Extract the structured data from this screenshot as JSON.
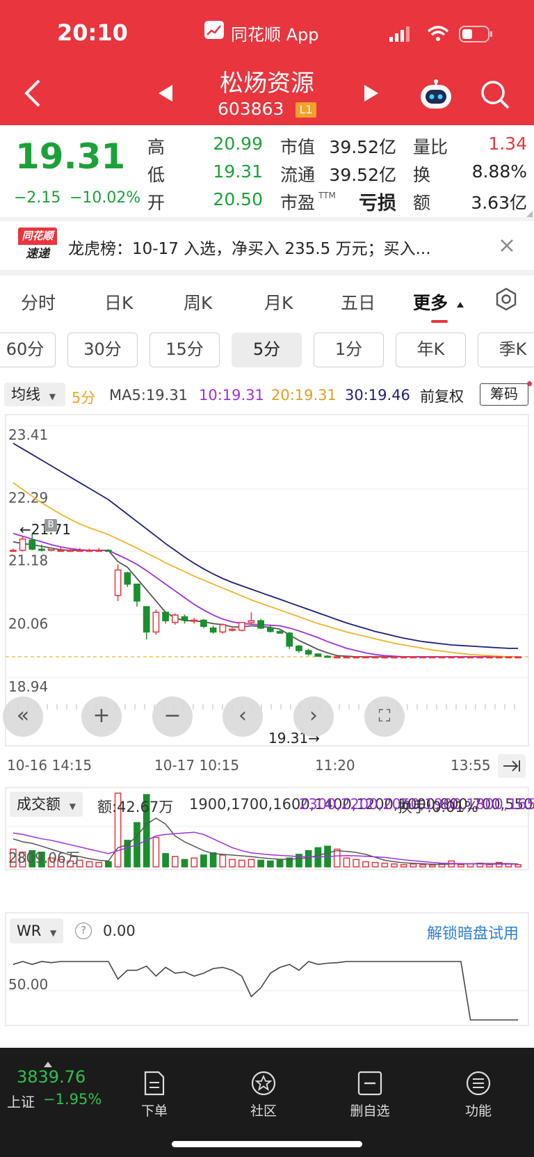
{
  "status": {
    "time": "20:10",
    "app_label": "同花顺 App"
  },
  "header": {
    "stock_name": "松炀资源",
    "stock_code": "603863",
    "level_badge": "L1"
  },
  "quote": {
    "price": "19.31",
    "change": "−2.15",
    "change_pct": "−10.02%",
    "high_label": "高",
    "high": "20.99",
    "low_label": "低",
    "low": "19.31",
    "open_label": "开",
    "open": "20.50",
    "mktcap_label": "市值",
    "mktcap": "39.52亿",
    "float_label": "流通",
    "float": "39.52亿",
    "pe_label": "市盈",
    "pe_sup": "TTM",
    "pe": "亏损",
    "volratio_label": "量比",
    "volratio": "1.34",
    "turnover_label": "换",
    "turnover": "8.88%",
    "amount_label": "额",
    "amount": "3.63亿"
  },
  "news": {
    "logo_top": "同花顺",
    "logo_bottom": "速递",
    "text": "龙虎榜：10-17 入选，净买入 235.5 万元；买入..."
  },
  "tabs": [
    {
      "label": "分时"
    },
    {
      "label": "日K"
    },
    {
      "label": "周K"
    },
    {
      "label": "月K"
    },
    {
      "label": "五日"
    },
    {
      "label": "更多"
    }
  ],
  "periods": [
    {
      "label": "60分"
    },
    {
      "label": "30分"
    },
    {
      "label": "15分"
    },
    {
      "label": "5分"
    },
    {
      "label": "1分"
    },
    {
      "label": "年K"
    },
    {
      "label": "季K"
    }
  ],
  "ma_row": {
    "select": "均线",
    "period": "5分",
    "ma5": "MA5:19.31",
    "ma10": "10:19.31",
    "ma20": "20:19.31",
    "ma30": "30:19.46",
    "adjust": "前复权",
    "chip": "筹码"
  },
  "colors": {
    "up": "#E9353E",
    "down": "#1A8F2E",
    "ma5": "#555555",
    "ma10": "#9B30E0",
    "ma20": "#F0B429",
    "ma30": "#1E1E7A",
    "brand": "#E9353E"
  },
  "chart_data": {
    "type": "candlestick",
    "y_ticks": [
      "23.41",
      "22.29",
      "21.18",
      "20.06",
      "18.94"
    ],
    "ylim": [
      18.94,
      23.41
    ],
    "x_ticks": [
      "10-16 14:15",
      "10-17 10:15",
      "11:20",
      "13:55"
    ],
    "high_marker": "←21.71",
    "low_marker": "19.31→",
    "candles": [
      [
        21.2,
        21.23,
        21.18,
        21.2
      ],
      [
        21.2,
        21.45,
        21.18,
        21.4
      ],
      [
        21.38,
        21.5,
        21.2,
        21.22
      ],
      [
        21.22,
        21.3,
        21.18,
        21.2
      ],
      [
        21.2,
        21.25,
        21.18,
        21.22
      ],
      [
        21.2,
        21.25,
        21.18,
        21.2
      ],
      [
        21.2,
        21.24,
        21.18,
        21.2
      ],
      [
        21.2,
        21.24,
        21.18,
        21.2
      ],
      [
        21.2,
        21.23,
        21.18,
        21.2
      ],
      [
        21.2,
        21.24,
        21.18,
        21.2
      ],
      [
        21.2,
        21.22,
        21.18,
        21.19
      ],
      [
        20.4,
        20.95,
        20.3,
        20.85
      ],
      [
        20.8,
        20.82,
        20.55,
        20.6
      ],
      [
        20.6,
        20.6,
        20.2,
        20.3
      ],
      [
        20.2,
        20.2,
        19.62,
        19.75
      ],
      [
        19.75,
        20.15,
        19.7,
        20.1
      ],
      [
        20.1,
        20.12,
        19.9,
        19.95
      ],
      [
        19.92,
        20.08,
        19.88,
        20.05
      ],
      [
        20.02,
        20.06,
        19.9,
        19.96
      ],
      [
        19.96,
        20.0,
        19.9,
        19.96
      ],
      [
        19.96,
        19.98,
        19.82,
        19.85
      ],
      [
        19.82,
        19.86,
        19.72,
        19.75
      ],
      [
        19.75,
        19.9,
        19.72,
        19.88
      ],
      [
        19.78,
        19.82,
        19.76,
        19.8
      ],
      [
        19.78,
        19.92,
        19.76,
        19.92
      ],
      [
        19.92,
        20.1,
        19.9,
        19.95
      ],
      [
        19.95,
        19.98,
        19.8,
        19.82
      ],
      [
        19.82,
        19.86,
        19.74,
        19.76
      ],
      [
        19.76,
        19.78,
        19.72,
        19.73
      ],
      [
        19.73,
        19.75,
        19.45,
        19.5
      ],
      [
        19.5,
        19.52,
        19.38,
        19.42
      ],
      [
        19.42,
        19.45,
        19.33,
        19.36
      ],
      [
        19.36,
        19.37,
        19.31,
        19.32
      ],
      [
        19.32,
        19.34,
        19.31,
        19.31
      ],
      [
        19.31,
        19.32,
        19.31,
        19.31
      ],
      [
        19.31,
        19.32,
        19.31,
        19.31
      ],
      [
        19.31,
        19.32,
        19.31,
        19.31
      ],
      [
        19.31,
        19.31,
        19.31,
        19.31
      ],
      [
        19.31,
        19.31,
        19.31,
        19.31
      ],
      [
        19.31,
        19.31,
        19.31,
        19.31
      ],
      [
        19.31,
        19.31,
        19.31,
        19.31
      ],
      [
        19.31,
        19.31,
        19.31,
        19.31
      ],
      [
        19.31,
        19.31,
        19.31,
        19.31
      ],
      [
        19.31,
        19.31,
        19.31,
        19.31
      ],
      [
        19.31,
        19.31,
        19.31,
        19.31
      ],
      [
        19.31,
        19.31,
        19.31,
        19.31
      ],
      [
        19.31,
        19.31,
        19.31,
        19.31
      ],
      [
        19.31,
        19.31,
        19.31,
        19.31
      ],
      [
        19.31,
        19.31,
        19.31,
        19.31
      ],
      [
        19.31,
        19.31,
        19.31,
        19.31
      ],
      [
        19.31,
        19.31,
        19.31,
        19.31
      ],
      [
        19.31,
        19.31,
        19.31,
        19.31
      ],
      [
        19.31,
        19.31,
        19.31,
        19.31
      ],
      [
        19.31,
        19.31,
        19.31,
        19.31
      ]
    ],
    "series": [
      {
        "name": "MA5",
        "values": [
          21.35,
          21.32,
          21.3,
          21.27,
          21.24,
          21.21,
          21.2,
          21.2,
          21.2,
          21.2,
          21.2,
          21.0,
          20.9,
          20.7,
          20.5,
          20.3,
          20.1,
          20.0,
          19.95,
          19.95,
          19.93,
          19.9,
          19.88,
          19.84,
          19.84,
          19.86,
          19.85,
          19.83,
          19.8,
          19.7,
          19.6,
          19.52,
          19.44,
          19.38,
          19.33,
          19.32,
          19.31,
          19.31,
          19.31,
          19.31,
          19.31,
          19.31,
          19.31,
          19.31,
          19.31,
          19.31,
          19.31,
          19.31,
          19.31,
          19.31,
          19.31,
          19.31,
          19.31,
          19.31
        ]
      },
      {
        "name": "MA10",
        "values": [
          21.5,
          21.45,
          21.4,
          21.35,
          21.3,
          21.26,
          21.23,
          21.21,
          21.2,
          21.2,
          21.2,
          21.12,
          21.04,
          20.95,
          20.84,
          20.72,
          20.6,
          20.48,
          20.36,
          20.24,
          20.14,
          20.05,
          19.98,
          19.93,
          19.9,
          19.89,
          19.88,
          19.87,
          19.86,
          19.82,
          19.77,
          19.71,
          19.65,
          19.58,
          19.52,
          19.46,
          19.42,
          19.38,
          19.35,
          19.33,
          19.32,
          19.31,
          19.31,
          19.31,
          19.31,
          19.31,
          19.31,
          19.31,
          19.31,
          19.31,
          19.31,
          19.31,
          19.31,
          19.31
        ]
      },
      {
        "name": "MA20",
        "values": [
          22.4,
          22.28,
          22.16,
          22.04,
          21.94,
          21.84,
          21.75,
          21.67,
          21.6,
          21.54,
          21.48,
          21.4,
          21.32,
          21.24,
          21.15,
          21.07,
          20.98,
          20.9,
          20.82,
          20.74,
          20.67,
          20.6,
          20.53,
          20.46,
          20.39,
          20.32,
          20.26,
          20.2,
          20.14,
          20.08,
          20.02,
          19.96,
          19.9,
          19.85,
          19.8,
          19.75,
          19.71,
          19.67,
          19.63,
          19.59,
          19.55,
          19.52,
          19.49,
          19.46,
          19.43,
          19.41,
          19.39,
          19.37,
          19.35,
          19.34,
          19.33,
          19.32,
          19.31,
          19.31
        ]
      },
      {
        "name": "MA30",
        "values": [
          23.1,
          23.0,
          22.9,
          22.8,
          22.7,
          22.6,
          22.5,
          22.4,
          22.3,
          22.2,
          22.1,
          21.97,
          21.84,
          21.71,
          21.58,
          21.45,
          21.32,
          21.2,
          21.08,
          20.97,
          20.87,
          20.78,
          20.7,
          20.63,
          20.57,
          20.51,
          20.45,
          20.39,
          20.33,
          20.27,
          20.21,
          20.15,
          20.09,
          20.03,
          19.97,
          19.91,
          19.86,
          19.81,
          19.76,
          19.72,
          19.68,
          19.64,
          19.61,
          19.58,
          19.56,
          19.54,
          19.52,
          19.51,
          19.5,
          19.49,
          19.48,
          19.47,
          19.46,
          19.46
        ]
      }
    ],
    "volume": {
      "select": "成交额",
      "amount": "额:42.67万",
      "ma5": [
        1900,
        1700,
        1600,
        1400,
        1200,
        1000,
        800,
        700,
        550,
        450,
        400,
        1300,
        1500,
        2100,
        2900,
        3300,
        2900,
        2100,
        1700,
        1400,
        1100,
        900,
        850,
        800,
        750,
        700,
        620,
        560,
        520,
        520,
        560,
        620,
        780,
        950,
        1100,
        1050,
        980,
        850,
        650,
        450,
        350,
        280,
        240,
        210,
        180,
        170,
        200,
        200,
        210,
        230,
        220,
        230,
        220,
        200
      ],
      "ma10": [
        2300,
        2200,
        2050,
        1900,
        1800,
        1650,
        1500,
        1350,
        1200,
        1050,
        900,
        1100,
        1300,
        1500,
        1800,
        2100,
        2200,
        2250,
        2300,
        2350,
        2200,
        1900,
        1600,
        1300,
        1100,
        950,
        880,
        820,
        780,
        740,
        700,
        680,
        680,
        700,
        740,
        760,
        750,
        720,
        680,
        640,
        560,
        480,
        420,
        360,
        300,
        250,
        230,
        220,
        210,
        200,
        190,
        190,
        190,
        190
      ],
      "turnover": "换手:0.01%",
      "y_tick": "2809.06万",
      "ylim": [
        0,
        5000
      ],
      "values": [
        1200,
        1000,
        1100,
        1000,
        600,
        500,
        400,
        450,
        350,
        300,
        350,
        5000,
        1800,
        3000,
        4900,
        2000,
        900,
        700,
        500,
        600,
        800,
        950,
        800,
        500,
        450,
        500,
        450,
        400,
        450,
        600,
        850,
        1100,
        1300,
        1400,
        1200,
        600,
        500,
        350,
        300,
        250,
        200,
        150,
        200,
        150,
        120,
        200,
        400,
        150,
        200,
        250,
        150,
        300,
        200,
        150
      ]
    },
    "wr": {
      "select": "WR",
      "value": "0.00",
      "unlock": "解锁暗盘试用",
      "y_tick": "50.00",
      "ylim": [
        0,
        100
      ],
      "values": [
        5,
        0,
        5,
        0,
        2,
        0,
        0,
        0,
        0,
        0,
        0,
        30,
        15,
        15,
        8,
        25,
        10,
        20,
        18,
        25,
        20,
        12,
        10,
        15,
        25,
        60,
        45,
        20,
        10,
        5,
        15,
        0,
        5,
        3,
        2,
        0,
        0,
        0,
        0,
        0,
        0,
        0,
        0,
        0,
        0,
        0,
        0,
        0,
        100,
        100,
        100,
        100,
        100,
        100
      ]
    }
  },
  "bottom_nav": {
    "index_value": "3839.76",
    "index_name": "上证",
    "index_change": "−1.95%",
    "order": "下单",
    "community": "社区",
    "remove": "删自选",
    "functions": "功能"
  }
}
